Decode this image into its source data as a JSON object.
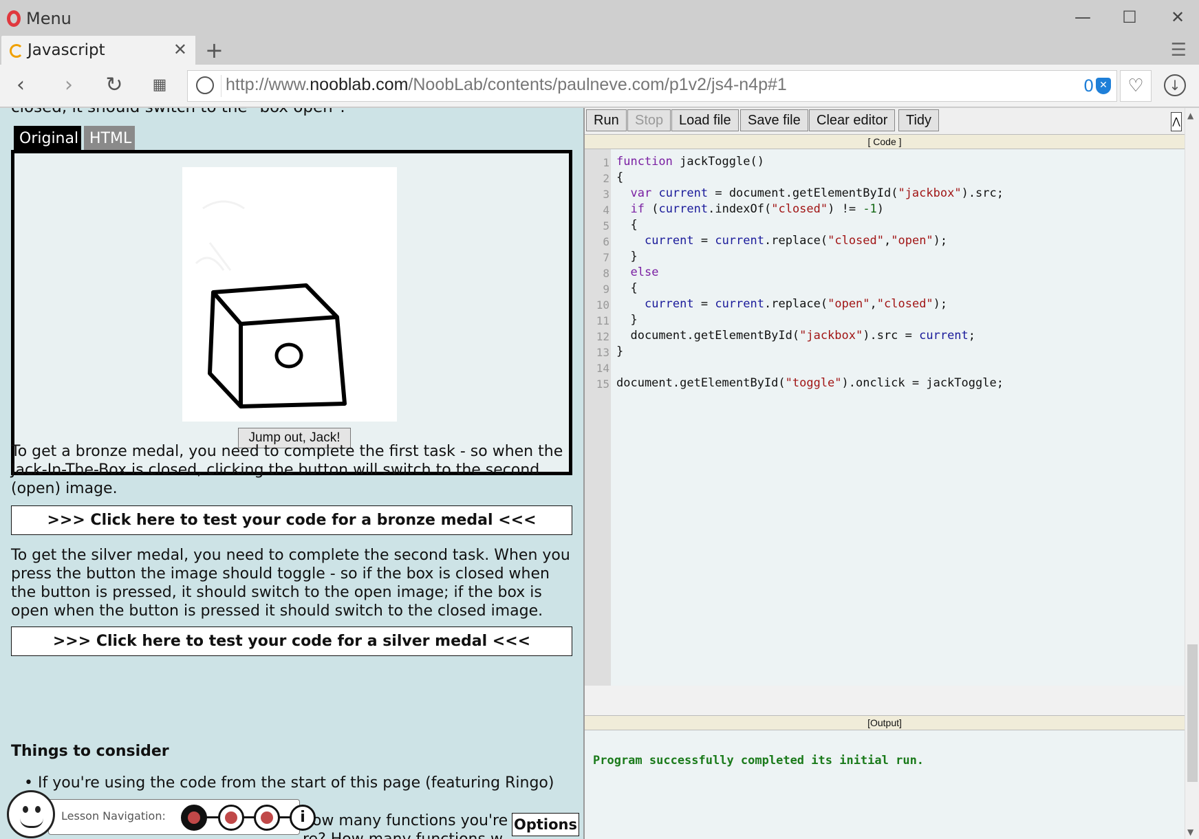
{
  "browser": {
    "menu_label": "Menu",
    "tab_title": "Javascript",
    "tab_close": "✕",
    "new_tab": "+",
    "url_prefix": "http://www.",
    "url_domain": "nooblab.com",
    "url_path": "/NoobLab/contents/paulneve.com/p1v2/js4-n4p#1",
    "adblock_count": "0",
    "window_controls": [
      "—",
      "☐",
      "✕"
    ]
  },
  "lesson": {
    "cut_text": "closed, it should switch to the \"box open\".",
    "tabs": [
      "Original",
      "HTML"
    ],
    "jump_button": "Jump out, Jack!",
    "bronze_text": "To get a bronze medal, you need to complete the first task - so when the Jack-In-The-Box is closed, clicking the button will switch to the second (open) image.",
    "bronze_button": ">>> Click here to test your code for a bronze medal <<<",
    "silver_text": "To get the silver medal, you need to complete the second task. When you press the button the image should toggle - so if the box is closed when the button is pressed, it should switch to the open image; if the box is open when the button is pressed it should switch to the closed image.",
    "silver_button": ">>> Click here to test your code for a silver medal <<<",
    "things_heading": "Things to consider",
    "bullet_text": "If you're using the code from the start of this page (featuring Ringo)",
    "bullet_frag_1": "how many functions you're going",
    "bullet_frag_2": "re? How many functions w",
    "nav_label": "Lesson Navigation:",
    "nav_info": "i",
    "options_button": "Options"
  },
  "editor": {
    "buttons": [
      "Run",
      "Stop",
      "Load file",
      "Save file",
      "Clear editor",
      "Tidy"
    ],
    "collapse": "⋀",
    "code_header": "[ Code ]",
    "output_header": "[Output]",
    "output_message": "Program successfully completed its initial run.",
    "line_numbers": [
      "1",
      "2",
      "3",
      "4",
      "5",
      "6",
      "7",
      "8",
      "9",
      "10",
      "11",
      "12",
      "13",
      "14",
      "15"
    ],
    "code_lines": [
      "function jackToggle()",
      "{",
      "  var current = document.getElementById(\"jackbox\").src;",
      "  if (current.indexOf(\"closed\") != -1)",
      "  {",
      "    current = current.replace(\"closed\",\"open\");",
      "  }",
      "  else",
      "  {",
      "    current = current.replace(\"open\",\"closed\");",
      "  }",
      "  document.getElementById(\"jackbox\").src = current;",
      "}",
      "",
      "document.getElementById(\"toggle\").onclick = jackToggle;"
    ]
  },
  "colors": {
    "page_bg": "#cde3e6",
    "keyword": "#7a1fa2",
    "string": "#a11515",
    "output": "#1a7a1a"
  }
}
